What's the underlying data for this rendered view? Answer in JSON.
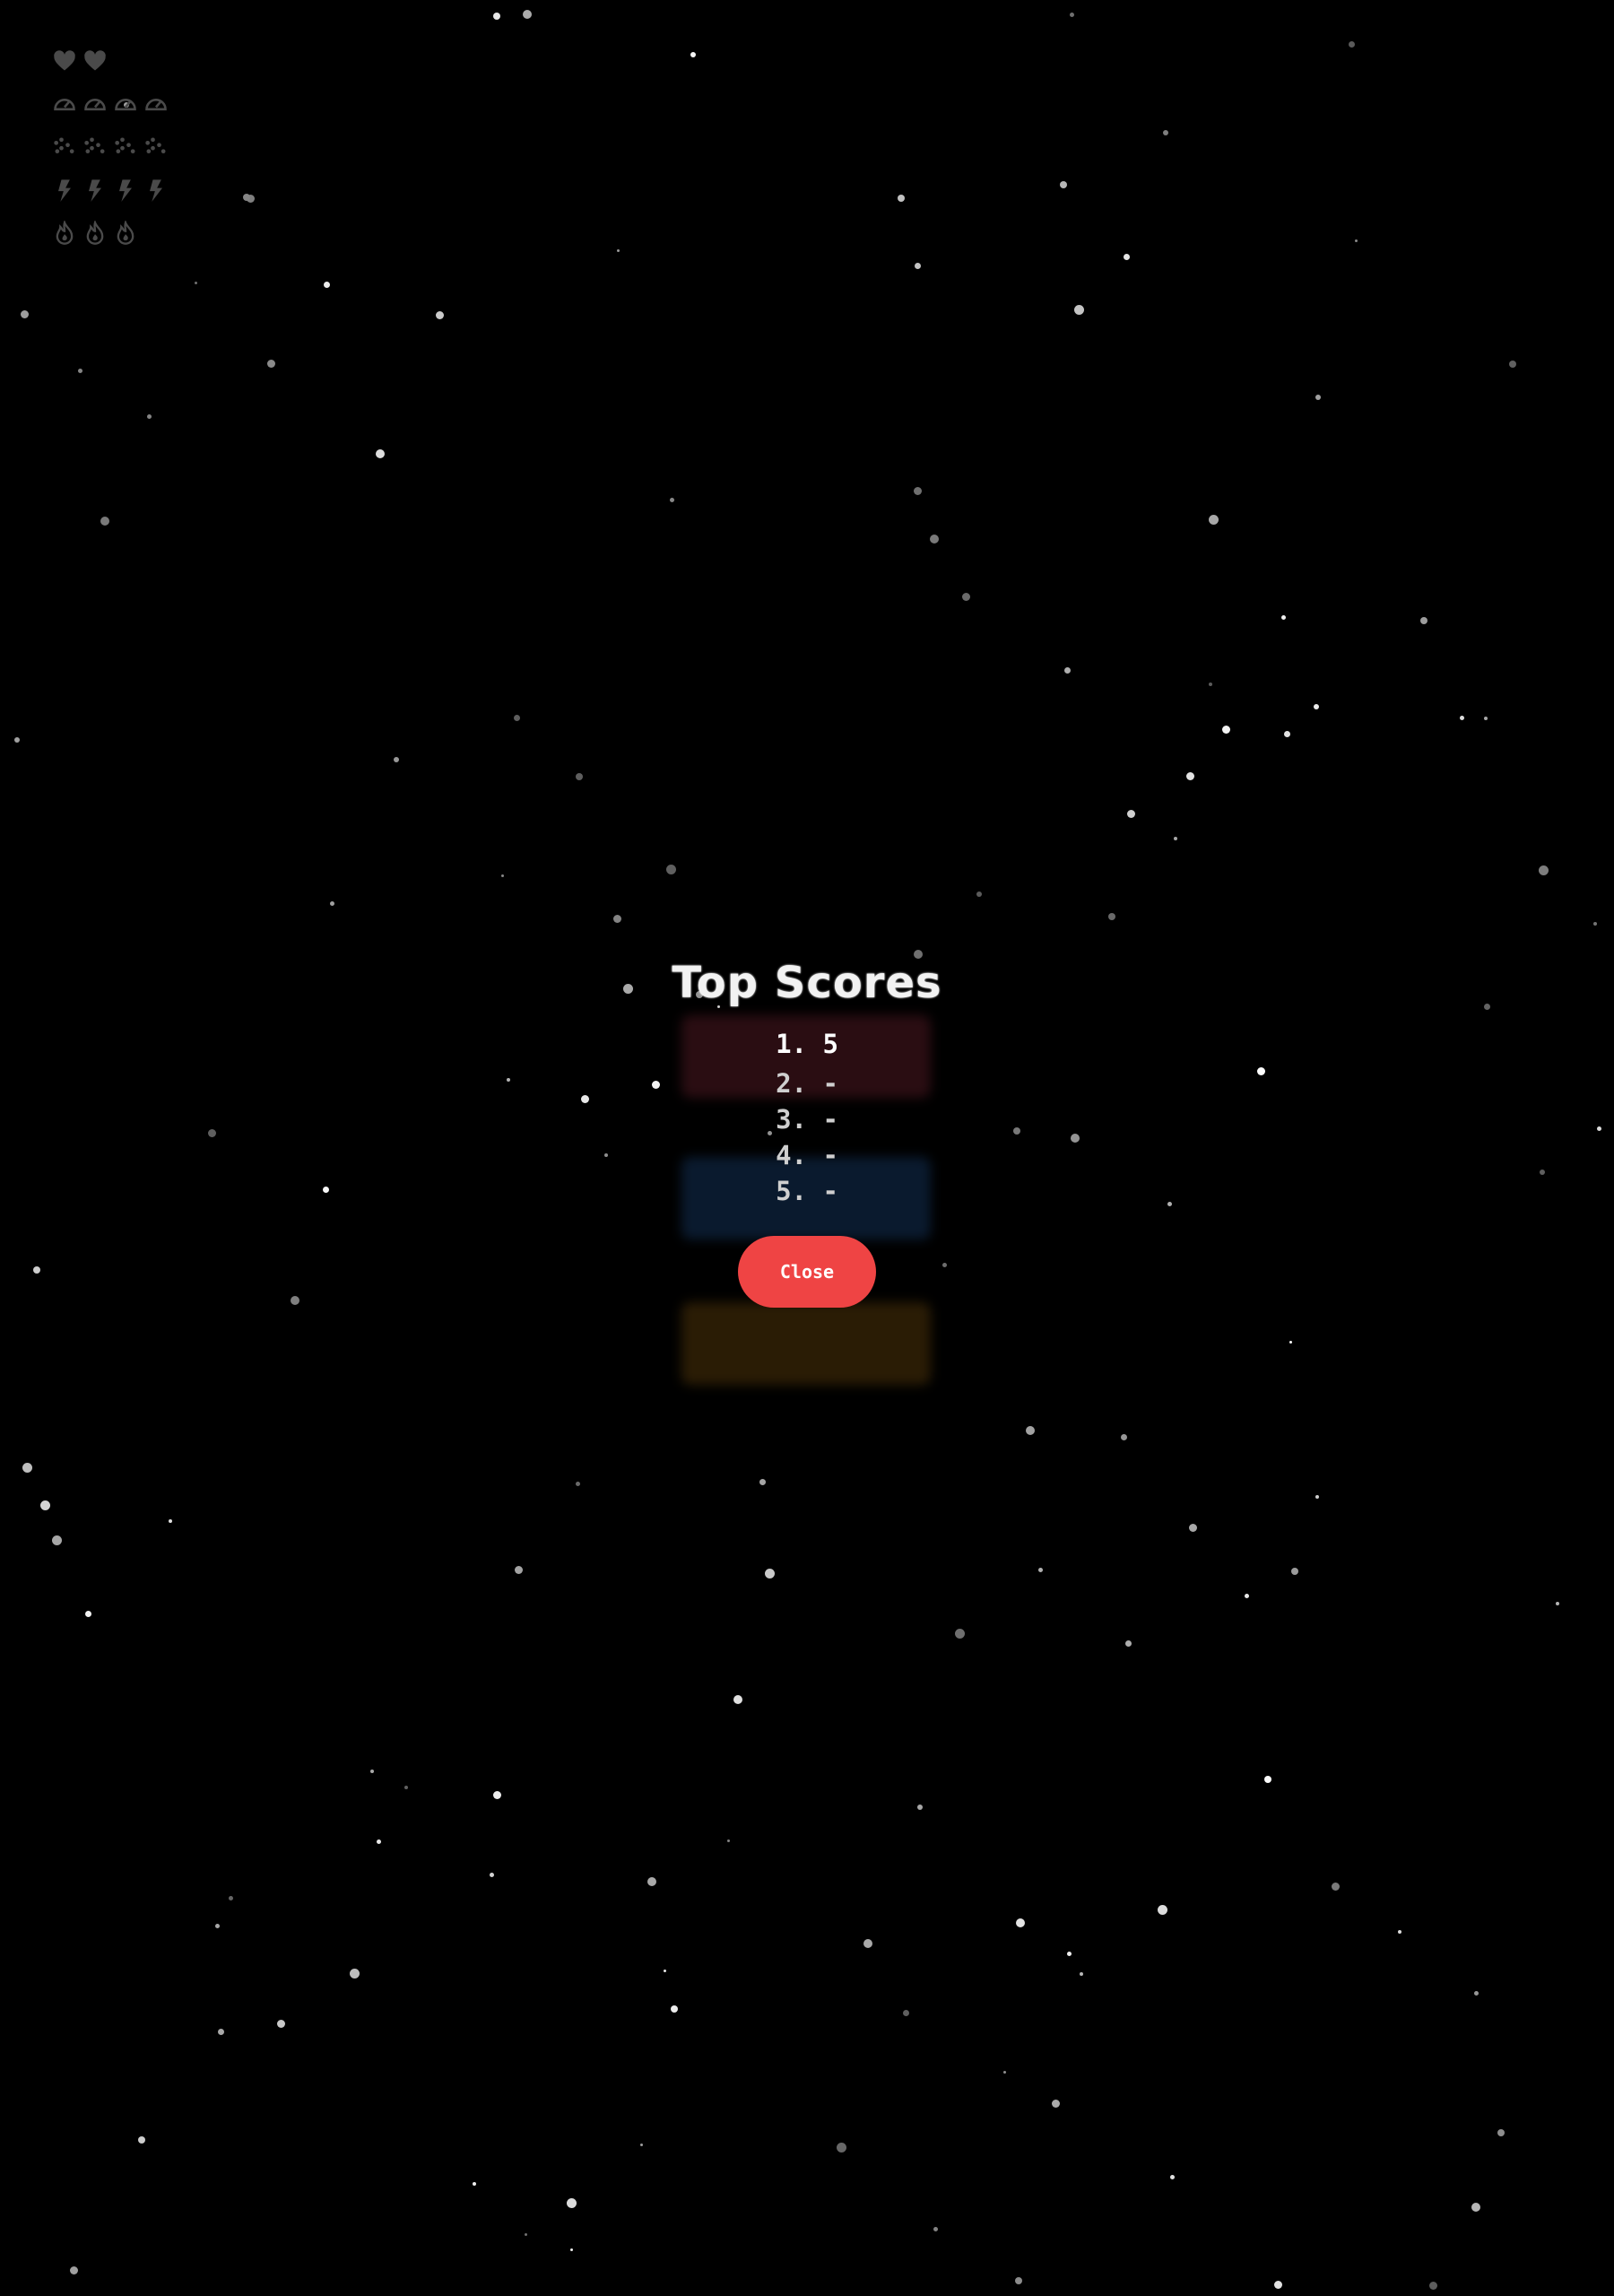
{
  "hud": {
    "lives": {
      "icon": "heart-icon",
      "count": 2
    },
    "speed": {
      "icon": "gauge-icon",
      "count": 4
    },
    "spread": {
      "icon": "spread-shot-icon",
      "count": 4
    },
    "power": {
      "icon": "lightning-icon",
      "count": 4
    },
    "fire": {
      "icon": "flame-icon",
      "count": 3
    },
    "icon_color": "#4a4a4a"
  },
  "scores": {
    "title": "Top Scores",
    "entries": [
      "1. 5",
      "2. -",
      "3. -",
      "4. -",
      "5. -"
    ]
  },
  "close_label": "Close",
  "colors": {
    "background": "#000000",
    "close_button": "#ef4444",
    "text": "#ffffff"
  }
}
